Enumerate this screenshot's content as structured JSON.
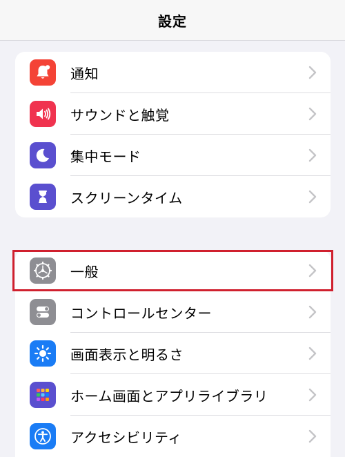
{
  "header": {
    "title": "設定"
  },
  "groups": [
    {
      "items": [
        {
          "label": "通知",
          "icon": "bell-icon",
          "icon_color": "#f44336"
        },
        {
          "label": "サウンドと触覚",
          "icon": "speaker-icon",
          "icon_color": "#f0334f"
        },
        {
          "label": "集中モード",
          "icon": "moon-icon",
          "icon_color": "#5a4fcf"
        },
        {
          "label": "スクリーンタイム",
          "icon": "hourglass-icon",
          "icon_color": "#5a4fcf"
        }
      ]
    },
    {
      "items": [
        {
          "label": "一般",
          "icon": "gear-icon",
          "icon_color": "#8e8e93",
          "highlighted": true
        },
        {
          "label": "コントロールセンター",
          "icon": "toggles-icon",
          "icon_color": "#8e8e93"
        },
        {
          "label": "画面表示と明るさ",
          "icon": "brightness-icon",
          "icon_color": "#1a7cf5"
        },
        {
          "label": "ホーム画面とアプリライブラリ",
          "icon": "app-grid-icon",
          "icon_color": "#5a4fcf"
        },
        {
          "label": "アクセシビリティ",
          "icon": "accessibility-icon",
          "icon_color": "#1a7cf5"
        }
      ]
    }
  ],
  "colors": {
    "background": "#f2f2f7",
    "highlight_border": "#d0202e",
    "chevron": "#c4c4c7"
  }
}
